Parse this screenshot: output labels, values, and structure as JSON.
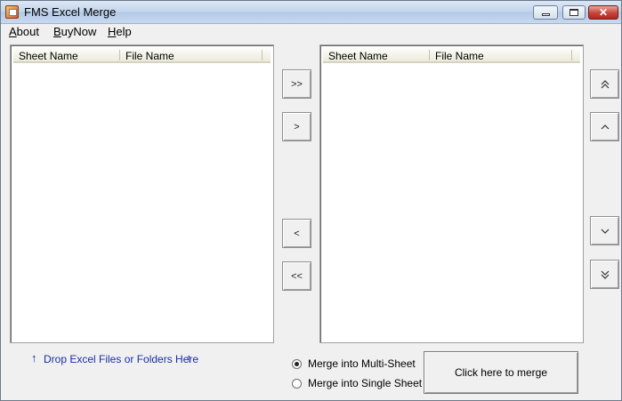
{
  "window": {
    "title": "FMS Excel Merge"
  },
  "menu": [
    {
      "accel": "A",
      "rest": "bout"
    },
    {
      "accel": "B",
      "rest": "uyNow"
    },
    {
      "accel": "H",
      "rest": "elp"
    }
  ],
  "left_list": {
    "columns": [
      "Sheet Name",
      "File Name"
    ]
  },
  "right_list": {
    "columns": [
      "Sheet Name",
      "File Name"
    ]
  },
  "transfer_buttons": {
    "add_all": ">>",
    "add": ">",
    "remove": "<",
    "remove_all": "<<"
  },
  "order_buttons": {
    "move_top": "move-top-icon",
    "move_up": "move-up-icon",
    "move_down": "move-down-icon",
    "move_bottom": "move-bottom-icon"
  },
  "drop_hint": {
    "text": "Drop Excel Files or Folders Here",
    "arrow": "↑"
  },
  "merge_options": [
    {
      "label": "Merge into Multi-Sheet",
      "selected": true
    },
    {
      "label": "Merge into Single Sheet",
      "selected": false
    }
  ],
  "merge_button": {
    "label": "Click here to merge"
  },
  "colors": {
    "hint_blue": "#1a2ea8",
    "close_red": "#c7443a"
  }
}
